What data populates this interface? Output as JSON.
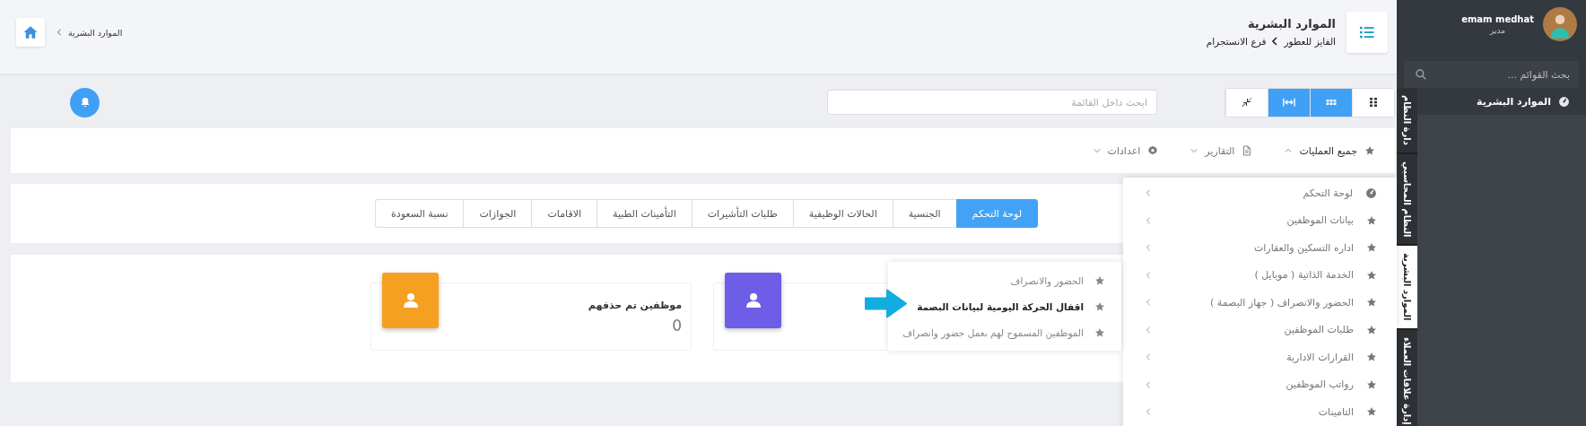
{
  "sidebar": {
    "user": {
      "name": "emam medhat",
      "role": "مدير"
    },
    "search": {
      "placeholder": "بحث القوائم ..."
    },
    "menu_items": [
      {
        "label": "الموارد البشرية"
      }
    ],
    "vertical_tabs": [
      {
        "label": "دارة النظام",
        "selected": false
      },
      {
        "label": "النظام المحاسبي",
        "selected": false
      },
      {
        "label": "الموارد البشرية",
        "selected": true
      },
      {
        "label": "إدارة علاقات العملاء",
        "selected": false
      }
    ]
  },
  "header": {
    "title": "الموارد البشرية",
    "breadcrumb": [
      "الفايز للعطور",
      "فرع الانستجرام"
    ],
    "home_label": "الموارد البشرية"
  },
  "toolbar": {
    "view_buttons": [
      {
        "kind": "grid",
        "selected": false
      },
      {
        "kind": "apps",
        "selected": true
      },
      {
        "kind": "expand",
        "selected": true
      },
      {
        "kind": "compress",
        "selected": false
      }
    ],
    "search": {
      "placeholder": "ابحث داخل القائمة"
    }
  },
  "menu_bar": [
    {
      "label": "جميع العمليات",
      "expanded": true
    },
    {
      "label": "التقارير",
      "expanded": false
    },
    {
      "label": "اعدادات",
      "expanded": false
    }
  ],
  "tabs": [
    {
      "label": "لوحة التحكم",
      "selected": true
    },
    {
      "label": "الجنسية",
      "selected": false
    },
    {
      "label": "الحالات الوظيفية",
      "selected": false
    },
    {
      "label": "طلبات التأشيرات",
      "selected": false
    },
    {
      "label": "التأمينات الطبية",
      "selected": false
    },
    {
      "label": "الاقامات",
      "selected": false
    },
    {
      "label": "الجوازات",
      "selected": false
    },
    {
      "label": "نسبة السعودة",
      "selected": false
    }
  ],
  "cards": [
    {
      "color": "#6e5de7"
    },
    {
      "title": "موظفين تم حذفهم",
      "value": "0",
      "color": "#f5a021"
    }
  ],
  "dropdown": {
    "items": [
      {
        "kind": "gauge",
        "label": "لوحة التحكم"
      },
      {
        "kind": "star",
        "label": "بيانات الموظفين"
      },
      {
        "kind": "star",
        "label": "اداره التسكين والعقارات"
      },
      {
        "kind": "star",
        "label": "الخدمة الذاتية ( موبايل )"
      },
      {
        "kind": "star",
        "label": "الحضور والانصراف ( جهاز البصمة )"
      },
      {
        "kind": "star",
        "label": "طلبات الموظفين"
      },
      {
        "kind": "star",
        "label": "القرارات الادارية"
      },
      {
        "kind": "star",
        "label": "رواتب الموظفين"
      },
      {
        "kind": "star",
        "label": "التامينات"
      }
    ],
    "submenu": [
      {
        "label": "الحضور والانصراف",
        "selected": false
      },
      {
        "label": "اقفال الحركة اليومية لبيانات البصمة",
        "selected": true
      },
      {
        "label": "الموظفين المسموح لهم بعمل حضور وانصراف",
        "selected": false
      }
    ]
  }
}
